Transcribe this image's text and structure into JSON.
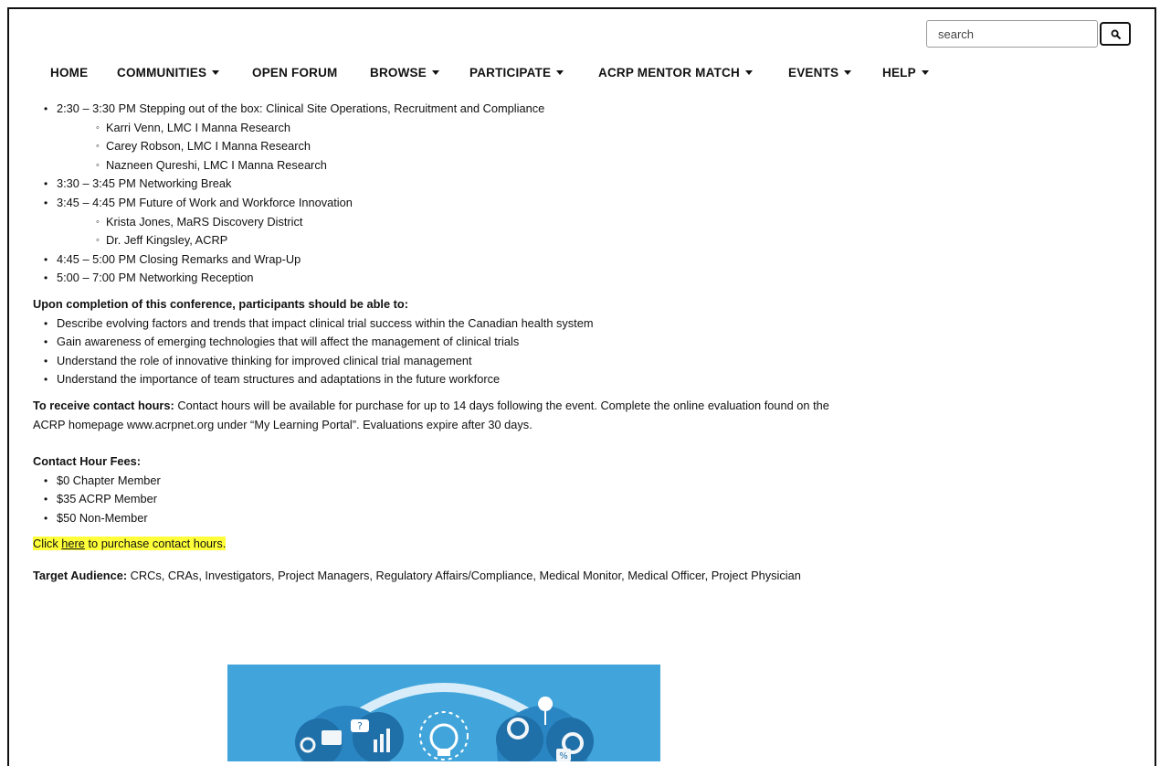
{
  "search": {
    "placeholder": "search"
  },
  "nav": {
    "items": [
      {
        "label": "HOME",
        "dropdown": false
      },
      {
        "label": "COMMUNITIES",
        "dropdown": true
      },
      {
        "label": "OPEN FORUM",
        "dropdown": false
      },
      {
        "label": "BROWSE",
        "dropdown": true
      },
      {
        "label": "PARTICIPATE",
        "dropdown": true
      },
      {
        "label": "ACRP MENTOR MATCH",
        "dropdown": true
      },
      {
        "label": "EVENTS",
        "dropdown": true
      },
      {
        "label": "HELP",
        "dropdown": true
      }
    ]
  },
  "agenda": {
    "items": [
      {
        "text": "2:30 – 3:30 PM Stepping out of the box: Clinical Site Operations, Recruitment and Compliance",
        "speakers": [
          "Karri Venn, LMC I Manna Research",
          "Carey Robson, LMC I Manna Research",
          "Nazneen Qureshi, LMC I Manna Research"
        ]
      },
      {
        "text": "3:30 – 3:45 PM Networking Break"
      },
      {
        "text": "3:45 – 4:45 PM Future of Work and Workforce Innovation",
        "speakers": [
          "Krista Jones, MaRS Discovery District",
          "Dr. Jeff Kingsley, ACRP"
        ]
      },
      {
        "text": "4:45 – 5:00 PM Closing Remarks and Wrap-Up"
      },
      {
        "text": "5:00 – 7:00 PM Networking Reception"
      }
    ]
  },
  "objectives": {
    "heading": "Upon completion of this conference, participants should be able to:",
    "items": [
      "Describe evolving factors and trends that impact clinical trial success within the Canadian health system",
      "Gain awareness of emerging technologies that will affect the management of clinical trials",
      "Understand the role of innovative thinking for improved clinical trial management",
      "Understand the importance of team structures and adaptations in the future workforce"
    ]
  },
  "contact_hours": {
    "label": "To receive contact hours:",
    "text": " Contact hours will be available for purchase for up to 14 days following the event. Complete the online evaluation found on the ACRP homepage www.acrpnet.org under “My Learning Portal”. Evaluations expire after 30 days."
  },
  "fees": {
    "heading": "Contact Hour Fees:",
    "items": [
      "$0 Chapter Member",
      "$35 ACRP Member",
      "$50 Non-Member"
    ]
  },
  "purchase": {
    "prefix": "Click ",
    "link": "here",
    "suffix": " to purchase contact hours."
  },
  "audience": {
    "label": "Target Audience:",
    "text": " CRCs, CRAs, Investigators, Project Managers, Regulatory Affairs/Compliance, Medical Monitor, Medical Officer, Project Physician"
  },
  "colors": {
    "highlight": "#ffff3a",
    "banner": "#3a9fd6"
  }
}
